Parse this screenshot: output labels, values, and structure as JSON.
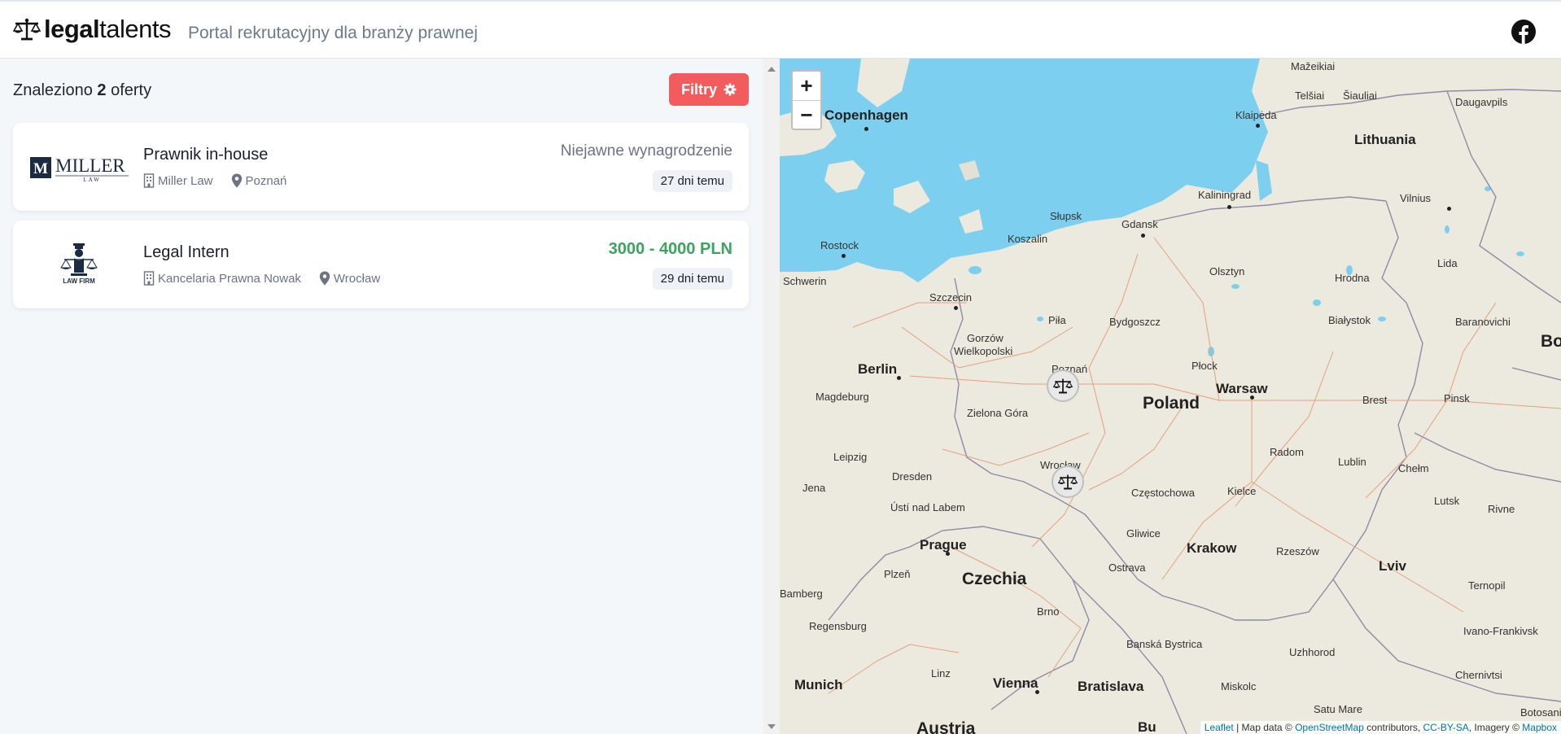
{
  "header": {
    "logo_bold": "legal",
    "logo_light": "talents",
    "tagline": "Portal rekrutacyjny dla branży prawnej"
  },
  "results": {
    "found_prefix": "Znaleziono ",
    "found_count": "2",
    "found_suffix": " oferty",
    "filter_label": "Filtry"
  },
  "jobs": [
    {
      "title": "Prawnik in-house",
      "company": "Miller Law",
      "city": "Poznań",
      "salary": "Niejawne wynagrodzenie",
      "date": "27 dni temu",
      "logo_main": "MILLER",
      "logo_sub": "LAW",
      "logo_letter": "M"
    },
    {
      "title": "Legal Intern",
      "company": "Kancelaria Prawna Nowak",
      "city": "Wrocław",
      "salary": "3000 - 4000 PLN",
      "date": "29 dni temu",
      "logo_main": "LAW FIRM"
    }
  ],
  "map": {
    "zoom_in": "+",
    "zoom_out": "−",
    "attribution": {
      "leaflet": "Leaflet",
      "map_data": " | Map data © ",
      "osm": "OpenStreetMap",
      "contributors": " contributors, ",
      "license": "CC-BY-SA",
      "imagery": ", Imagery © ",
      "provider": "Mapbox"
    },
    "labels": {
      "copenhagen": "Copenhagen",
      "lithuania": "Lithuania",
      "klaipeda": "Klaipėda",
      "mazeikiai": "Mažeikiai",
      "telsiai": "Telšiai",
      "siauliai": "Šiauliai",
      "daugavpils": "Daugavpils",
      "kaliningrad": "Kaliningrad",
      "vilnius": "Vilnius",
      "slupsk": "Słupsk",
      "gdansk": "Gdansk",
      "koszalin": "Koszalin",
      "rostock": "Rostock",
      "olsztyn": "Olsztyn",
      "hrodna": "Hrodna",
      "lida": "Lida",
      "schwerin": "Schwerin",
      "szczecin": "Szczecin",
      "pila": "Piła",
      "bydgoszcz": "Bydgoszcz",
      "bialystok": "Białystok",
      "baranovichi": "Baranovichi",
      "gorzow": "Gorzów",
      "wielkopolski": "Wielkopolski",
      "berlin": "Berlin",
      "poznan": "Poznań",
      "plock": "Płock",
      "warsaw": "Warsaw",
      "poland": "Poland",
      "magdeburg": "Magdeburg",
      "zielona": "Zielona Góra",
      "brest": "Brest",
      "pinsk": "Pinsk",
      "leipzig": "Leipzig",
      "radom": "Radom",
      "lublin": "Lublin",
      "chelm": "Chełm",
      "wroclaw": "Wrocław",
      "jena": "Jena",
      "dresden": "Dresden",
      "czestochowa": "Częstochowa",
      "kielce": "Kielce",
      "lutsk": "Lutsk",
      "rivne": "Rivne",
      "usti": "Ústí nad Labem",
      "prague": "Prague",
      "gliwice": "Gliwice",
      "krakow": "Krakow",
      "rzeszow": "Rzeszów",
      "plzen": "Plzeň",
      "czechia": "Czechia",
      "ostrava": "Ostrava",
      "lviv": "Lviv",
      "ternopil": "Ternopil",
      "bamberg": "Bamberg",
      "regensburg": "Regensburg",
      "brno": "Brno",
      "banska": "Banská Bystrica",
      "uzhhorod": "Uzhhorod",
      "ivano": "Ivano-Frankivsk",
      "munich": "Munich",
      "linz": "Linz",
      "vienna": "Vienna",
      "bratislava": "Bratislava",
      "miskolc": "Miskolc",
      "chernivtsi": "Chernivtsi",
      "austria": "Austria",
      "satu": "Satu Mare",
      "botosani": "Botosani",
      "bo": "Bo",
      "bu": "Bu"
    }
  },
  "colors": {
    "accent": "#f25c5c",
    "salary_green": "#3aa55d",
    "water": "#7dcfef",
    "land": "#eae7dd"
  }
}
